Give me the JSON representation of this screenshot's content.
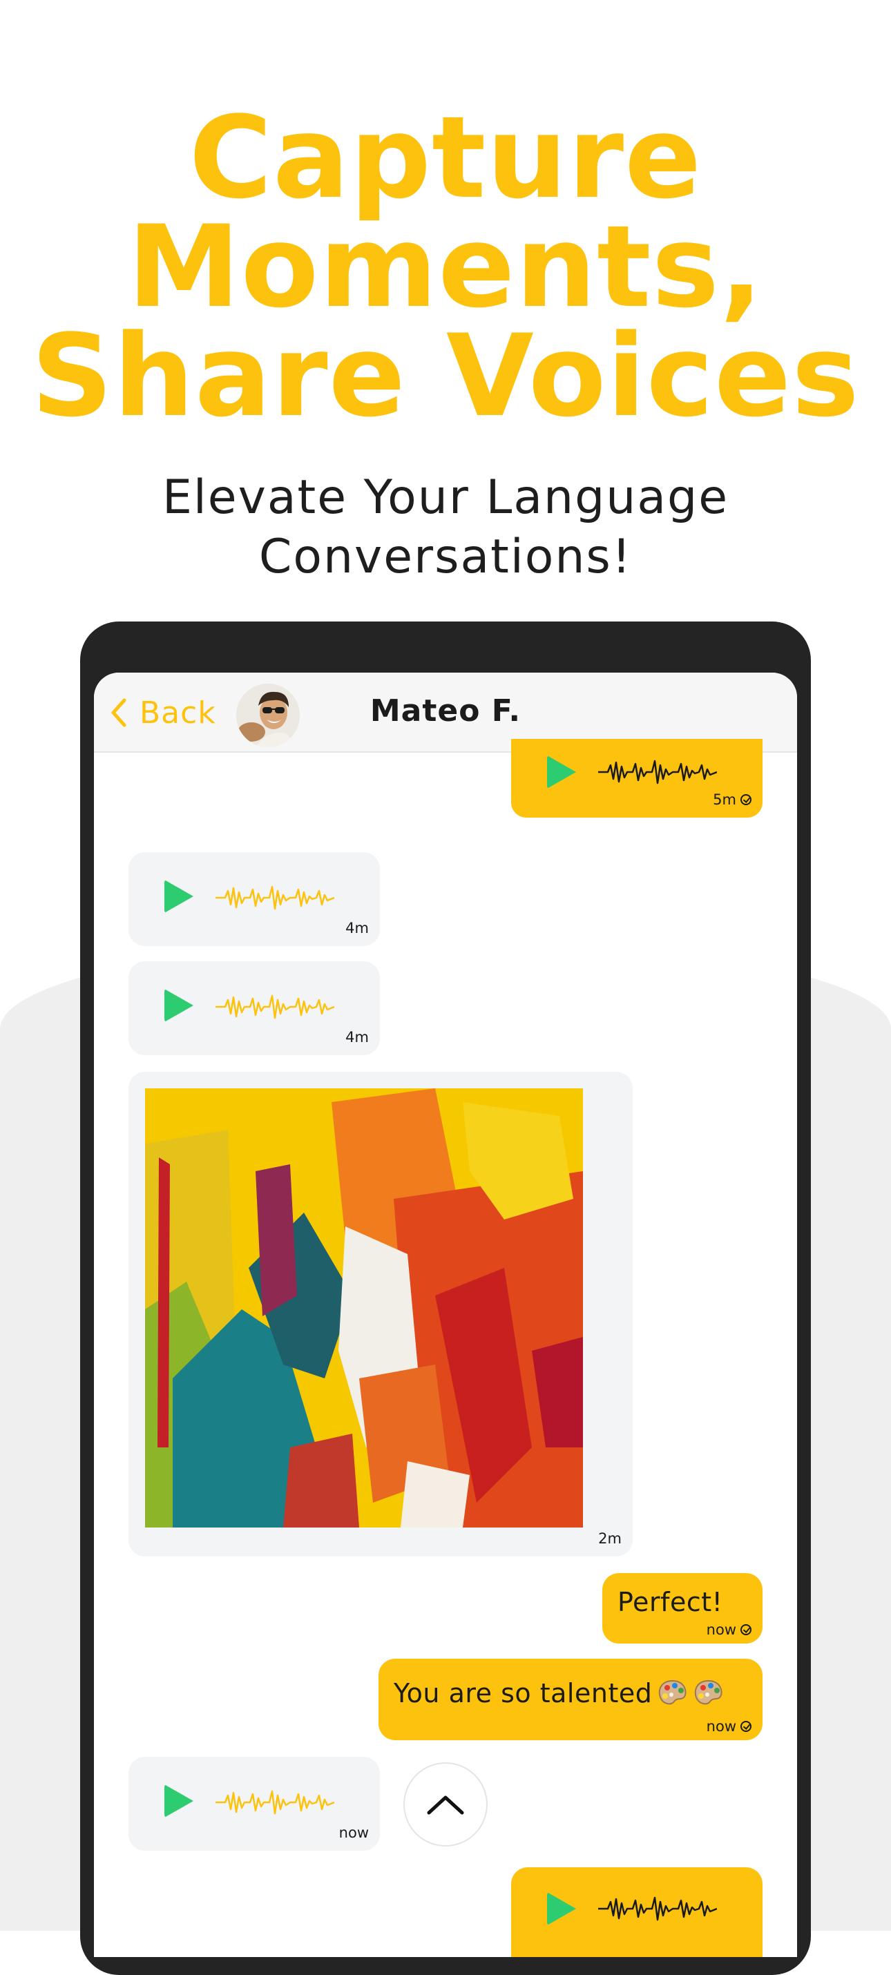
{
  "headline": {
    "line1": "Capture",
    "line2": "Moments,",
    "line3": "Share Voices"
  },
  "subtitle": {
    "line1": "Elevate Your Language",
    "line2": "Conversations!"
  },
  "chat": {
    "back_label": "Back",
    "contact_name": "Mateo F.",
    "messages": [
      {
        "type": "voice",
        "direction": "out",
        "time": "5m"
      },
      {
        "type": "voice",
        "direction": "in",
        "time": "4m"
      },
      {
        "type": "voice",
        "direction": "in",
        "time": "4m"
      },
      {
        "type": "image",
        "direction": "in",
        "time": "2m"
      },
      {
        "type": "text",
        "direction": "out",
        "text": "Perfect!",
        "time": "now"
      },
      {
        "type": "text",
        "direction": "out",
        "text": "You are so talented",
        "emoji": "palette-icon x2",
        "time": "now"
      },
      {
        "type": "voice",
        "direction": "in",
        "time": "now"
      },
      {
        "type": "voice",
        "direction": "out",
        "time": ""
      }
    ]
  },
  "colors": {
    "accent": "#FDC20E",
    "play": "#2ECC71",
    "incoming_bubble": "#f3f4f6",
    "device": "#242424"
  },
  "icons": [
    "chevron-left-icon",
    "play-icon",
    "waveform-icon",
    "read-check-icon",
    "chevron-up-icon",
    "palette-icon"
  ]
}
